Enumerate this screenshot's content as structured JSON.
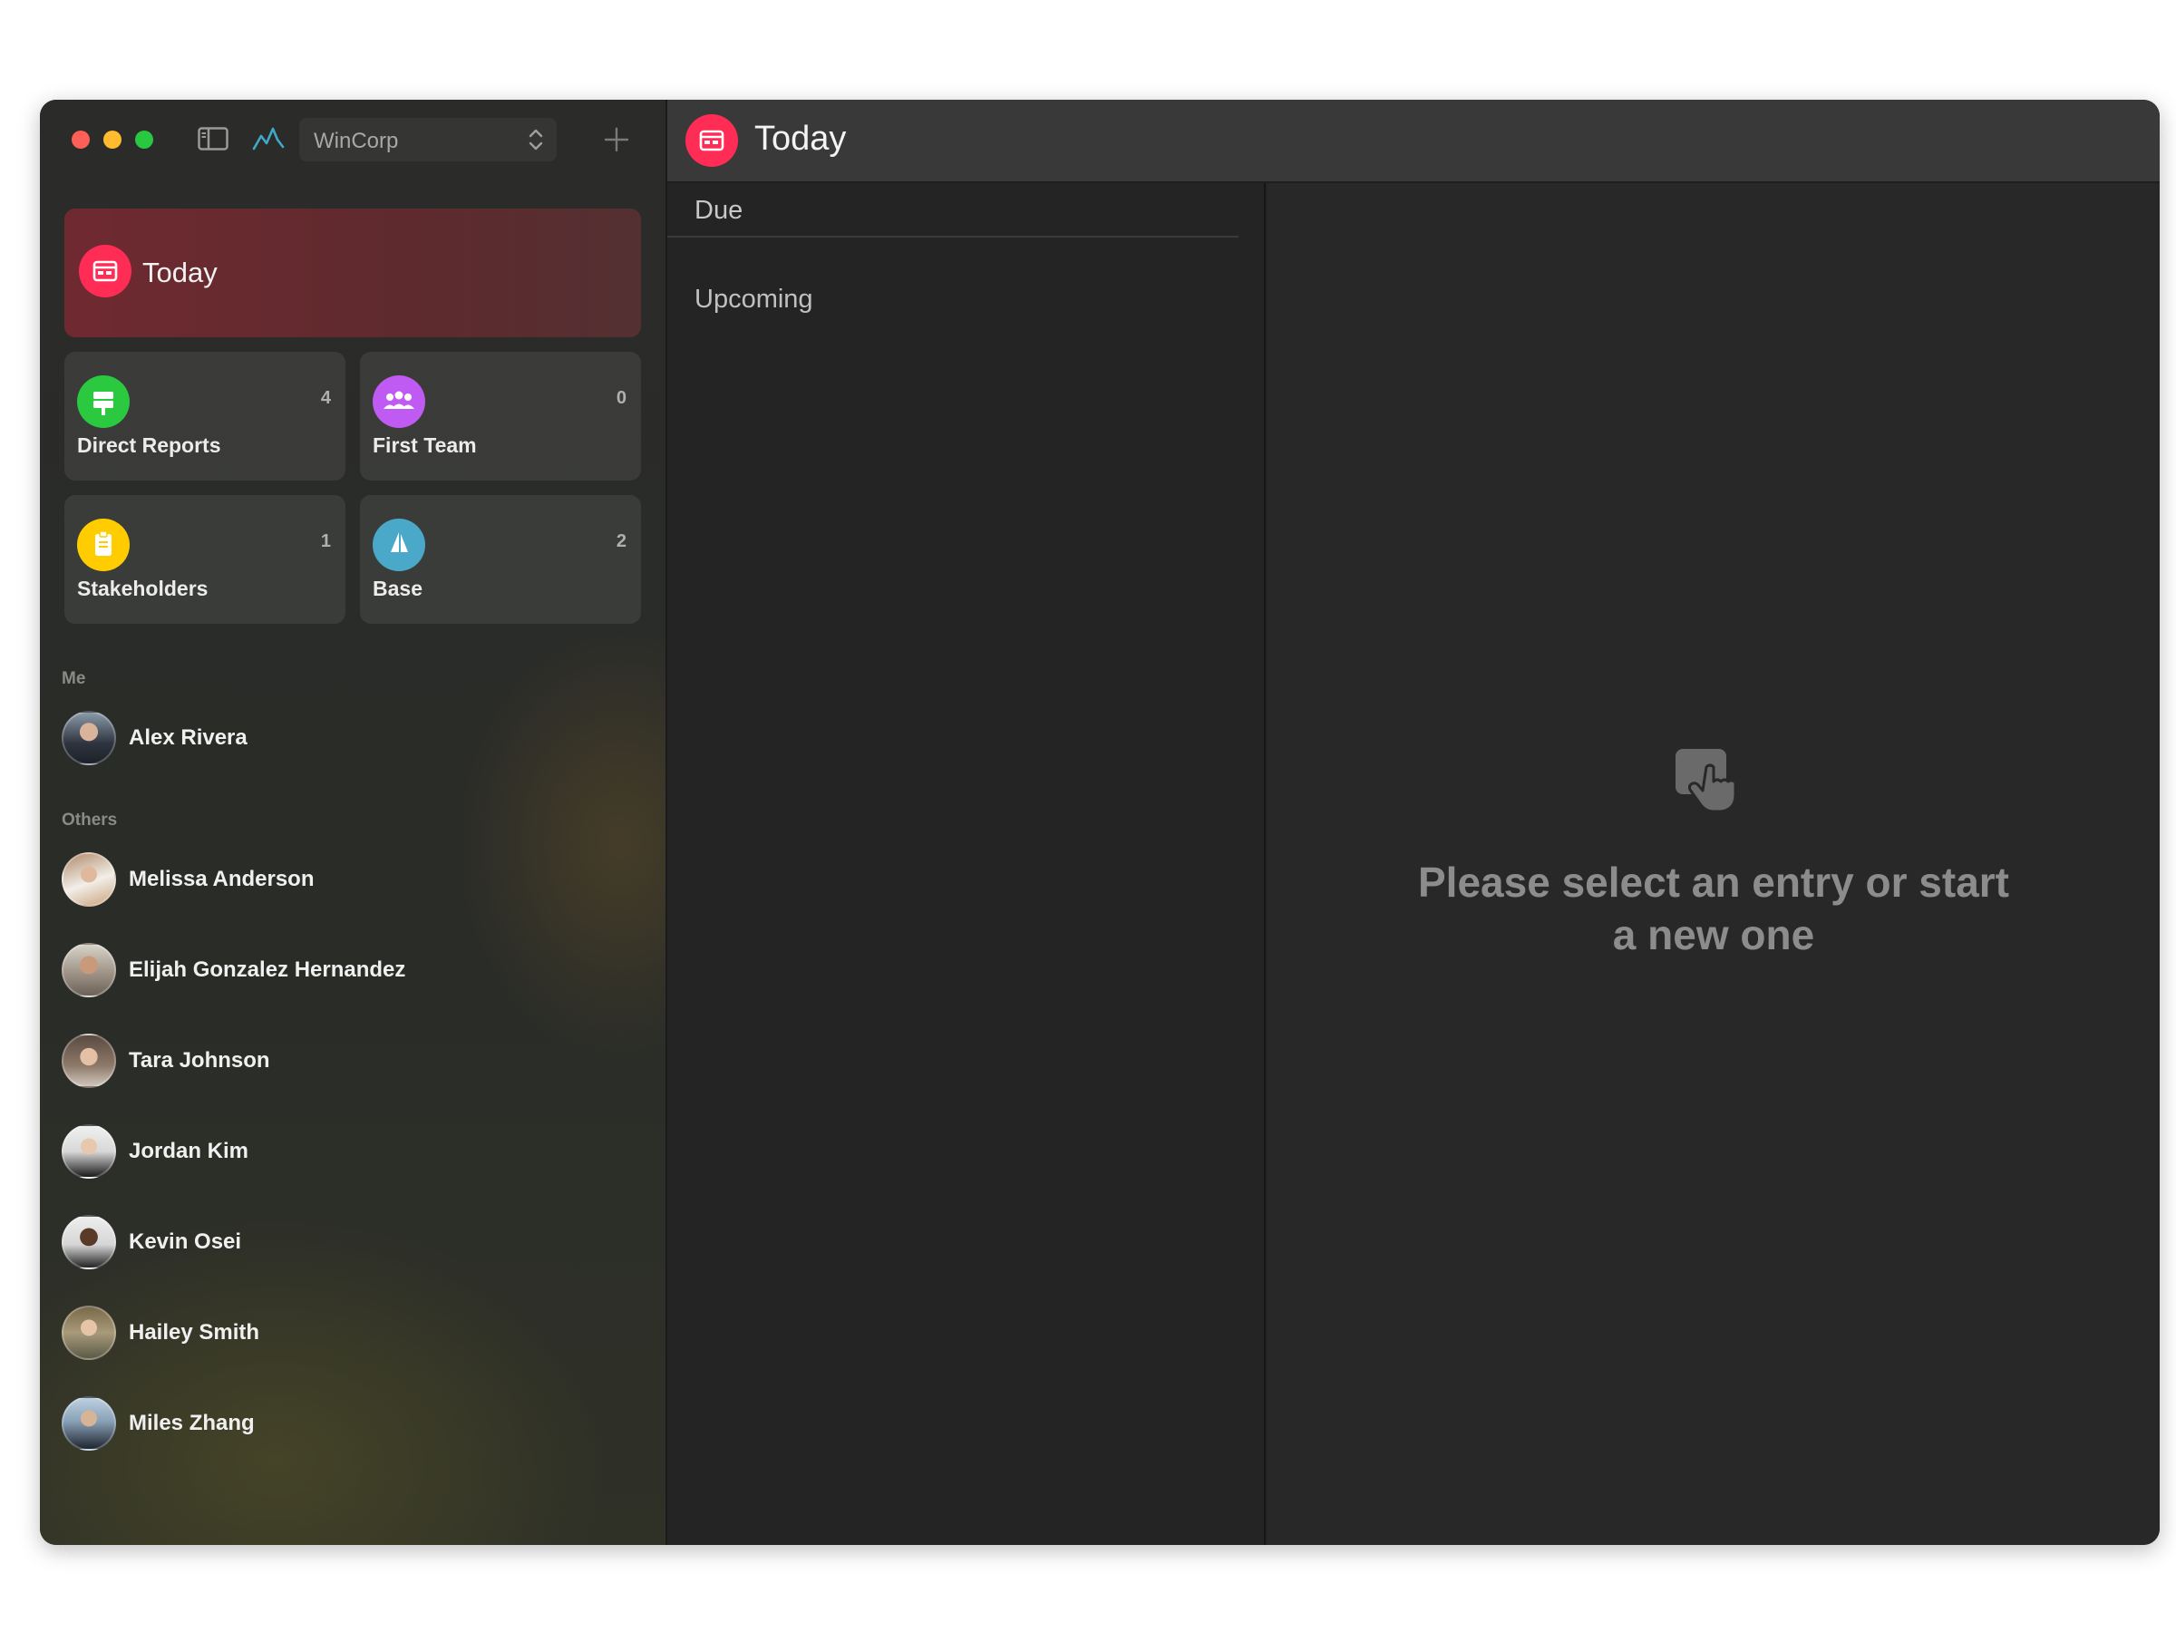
{
  "sidebar": {
    "org_select": {
      "value": "WinCorp"
    },
    "today": {
      "label": "Today",
      "color": "#ff2d55"
    },
    "groups": [
      {
        "label": "Direct Reports",
        "count": "4",
        "icon": "signpost-icon",
        "color": "#2ac940"
      },
      {
        "label": "First Team",
        "count": "0",
        "icon": "people-icon",
        "color": "#bf5af2"
      },
      {
        "label": "Stakeholders",
        "count": "1",
        "icon": "clipboard-icon",
        "color": "#ffcc00"
      },
      {
        "label": "Base",
        "count": "2",
        "icon": "sailboat-icon",
        "color": "#4aa8c9"
      }
    ],
    "me_label": "Me",
    "me": {
      "name": "Alex Rivera"
    },
    "others_label": "Others",
    "others": [
      {
        "name": "Melissa Anderson"
      },
      {
        "name": "Elijah Gonzalez Hernandez"
      },
      {
        "name": "Tara Johnson"
      },
      {
        "name": "Jordan Kim"
      },
      {
        "name": "Kevin Osei"
      },
      {
        "name": "Hailey Smith"
      },
      {
        "name": "Miles Zhang"
      }
    ]
  },
  "main": {
    "title": "Today",
    "list": {
      "due_label": "Due",
      "upcoming_label": "Upcoming"
    },
    "detail": {
      "empty_message": "Please select an entry or start a new one"
    }
  }
}
